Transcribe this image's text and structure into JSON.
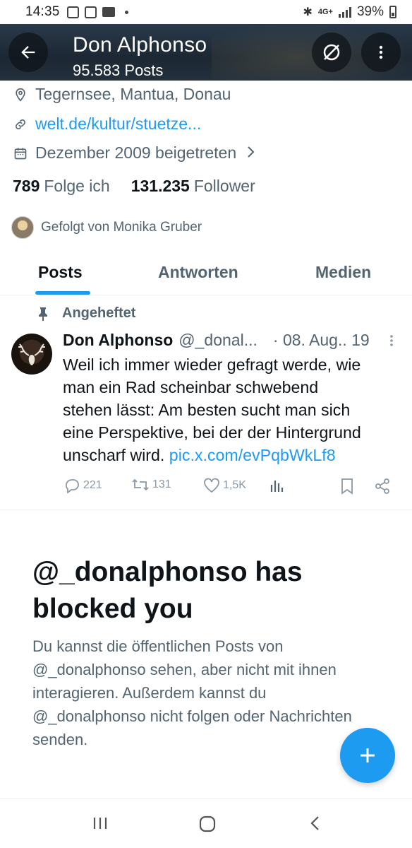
{
  "status_bar": {
    "time": "14:35",
    "network": "4G+",
    "battery": "39%"
  },
  "header": {
    "title": "Don Alphonso",
    "subtitle": "95.583 Posts"
  },
  "profile": {
    "location": "Tegernsee, Mantua, Donau",
    "website": "welt.de/kultur/stuetze...",
    "joined": "Dezember 2009 beigetreten",
    "following_count": "789",
    "following_label": "Folge ich",
    "followers_count": "131.235",
    "followers_label": "Follower",
    "followed_by": "Gefolgt von Monika Gruber"
  },
  "tabs": [
    {
      "label": "Posts",
      "active": true
    },
    {
      "label": "Antworten",
      "active": false
    },
    {
      "label": "Medien",
      "active": false
    }
  ],
  "pinned_post": {
    "pinned_label": "Angeheftet",
    "author_name": "Don Alphonso",
    "handle": "@_donal...",
    "date": "· 08. Aug.. 19",
    "text": "Weil ich immer wieder gefragt werde, wie\nman ein Rad scheinbar schwebend\nstehen lässt: Am besten sucht man sich\neine Perspektive, bei der der Hintergrund\nunscharf wird.",
    "link": "pic.x.com/evPqbWkLf8",
    "replies": "221",
    "reposts": "131",
    "likes": "1,5K"
  },
  "blocked": {
    "title": "@_donalphonso has blocked you",
    "body": "Du kannst die öffentlichen Posts von @_donalphonso sehen, aber nicht mit ihnen interagieren. Außerdem kannst du @_donalphonso nicht folgen oder Nachrichten senden."
  },
  "colors": {
    "accent": "#1d9bf0",
    "text_primary": "#0f1419",
    "text_secondary": "#536471"
  }
}
